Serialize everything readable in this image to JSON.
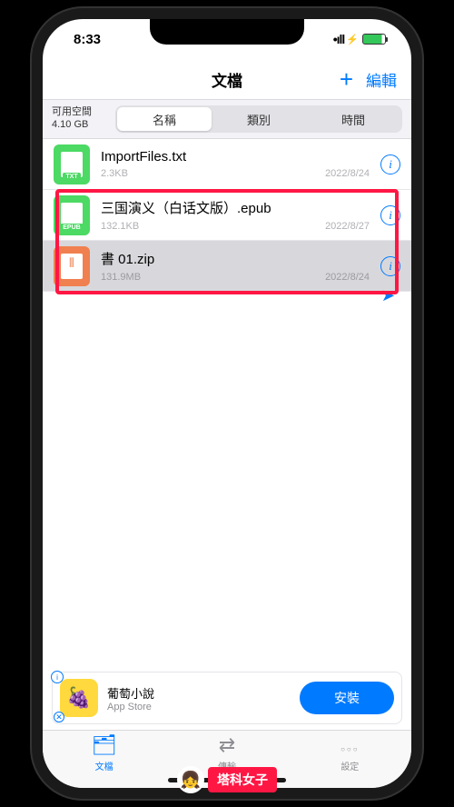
{
  "statusbar": {
    "time": "8:33"
  },
  "nav": {
    "title": "文檔",
    "edit": "編輯"
  },
  "storage": {
    "label": "可用空間",
    "value": "4.10 GB"
  },
  "segments": {
    "name": "名稱",
    "type": "類別",
    "time": "時間"
  },
  "files": [
    {
      "name": "ImportFiles.txt",
      "size": "2.3KB",
      "date": "2022/8/24",
      "ext": "TXT"
    },
    {
      "name": "三国演义（白话文版）.epub",
      "size": "132.1KB",
      "date": "2022/8/27",
      "ext": "EPUB"
    },
    {
      "name": "書 01.zip",
      "size": "131.9MB",
      "date": "2022/8/24",
      "ext": "ZIP"
    }
  ],
  "ad": {
    "title": "葡萄小說",
    "subtitle": "App Store",
    "cta": "安裝"
  },
  "tabs": {
    "files": "文檔",
    "transfer": "傳輸",
    "settings": "設定"
  },
  "watermark": "塔科女子"
}
